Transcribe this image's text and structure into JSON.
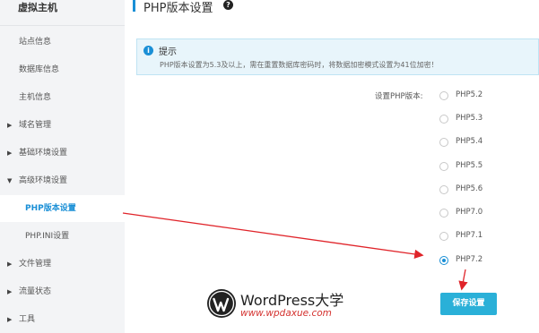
{
  "sidebar": {
    "title": "虚拟主机",
    "items": [
      {
        "label": "站点信息"
      },
      {
        "label": "数据库信息"
      },
      {
        "label": "主机信息"
      },
      {
        "label": "域名管理"
      },
      {
        "label": "基础环境设置"
      },
      {
        "label": "高级环境设置"
      },
      {
        "label": "PHP版本设置"
      },
      {
        "label": "PHP.INI设置"
      },
      {
        "label": "文件管理"
      },
      {
        "label": "流量状态"
      },
      {
        "label": "工具"
      }
    ]
  },
  "header": {
    "title": "PHP版本设置",
    "help_icon": "?"
  },
  "tip": {
    "icon": "i",
    "title": "提示",
    "text": "PHP版本设置为5.3及以上，需在重置数据库密码时，将数据加密模式设置为41位加密！"
  },
  "form": {
    "label": "设置PHP版本:",
    "options": [
      "PHP5.2",
      "PHP5.3",
      "PHP5.4",
      "PHP5.5",
      "PHP5.6",
      "PHP7.0",
      "PHP7.1",
      "PHP7.2"
    ],
    "selected": "PHP7.2",
    "save_label": "保存设置"
  },
  "watermark": {
    "title": "WordPress大学",
    "url": "www.wpdaxue.com"
  },
  "colors": {
    "accent": "#1a8fd6",
    "button": "#2ab0d8",
    "arrow": "#e0242a",
    "sidebar_bg": "#f3f4f6"
  }
}
